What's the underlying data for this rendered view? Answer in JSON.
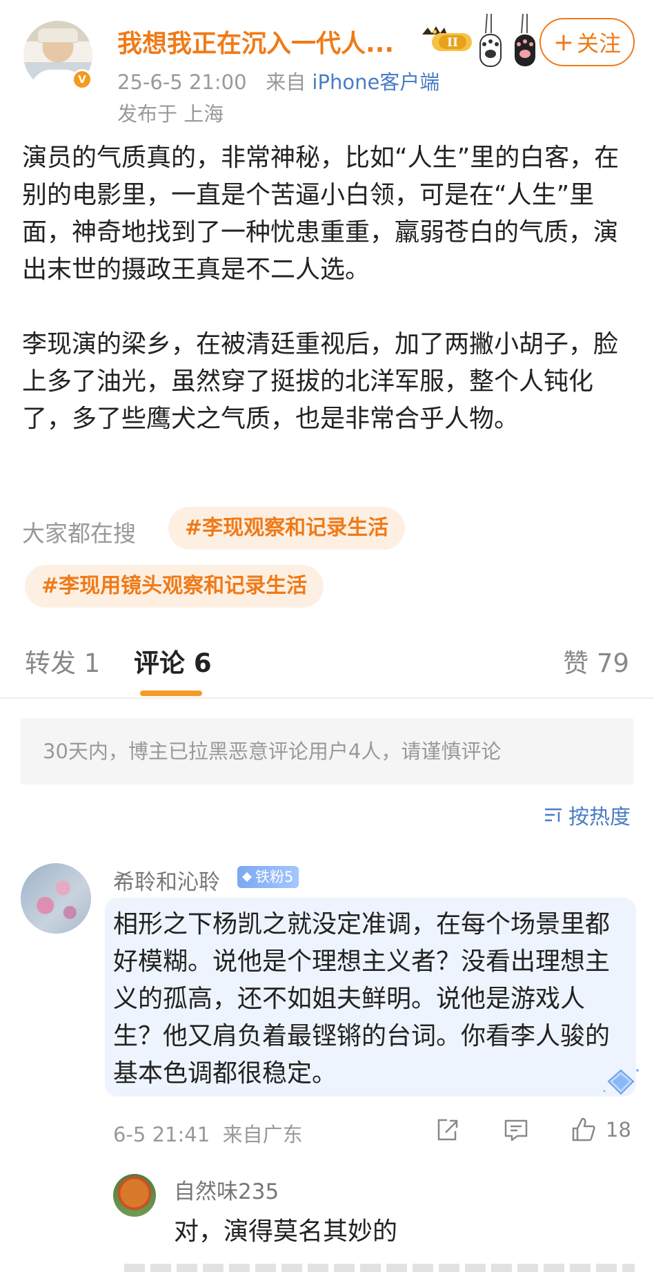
{
  "post": {
    "author": "我想我正在沉入一代人...",
    "verified_mark": "V",
    "level_badge": "II",
    "follow_label": "关注",
    "follow_plus": "+",
    "date": "25-6-5 21:00",
    "source_prefix": "来自",
    "source": "iPhone客户端",
    "location": "发布于 上海",
    "paragraphs": [
      "演员的气质真的，非常神秘，比如“人生”里的白客，在别的电影里，一直是个苦逼小白领，可是在“人生”里面，神奇地找到了一种忧患重重，羸弱苍白的气质，演出末世的摄政王真是不二人选。",
      "李现演的梁乡，在被清廷重视后，加了两撇小胡子，脸上多了油光，虽然穿了挺拔的北洋军服，整个人钝化了，多了些鹰犬之气质，也是非常合乎人物。"
    ],
    "search_label": "大家都在搜",
    "tags": [
      "#李现观察和记录生活",
      "#李现用镜头观察和记录生活"
    ]
  },
  "tabs": {
    "repost": "转发 1",
    "comment": "评论 6",
    "like": "赞 79"
  },
  "notice": "30天内，博主已拉黑恶意评论用户4人，请谨慎评论",
  "sort": "按热度",
  "comments": [
    {
      "user": "希聆和沁聆",
      "badge": "铁粉5",
      "text": "相形之下杨凯之就没定准调，在每个场景里都好模糊。说他是个理想主义者？没看出理想主义的孤高，还不如姐夫鲜明。说他是游戏人生？他又肩负着最铿锵的台词。你看李人骏的基本色调都很稳定。",
      "date": "6-5 21:41",
      "source": "来自广东",
      "likes": "18",
      "reply": {
        "user": "自然味235",
        "text": "对，演得莫名其妙的"
      }
    }
  ],
  "colors": {
    "accent": "#f07a18",
    "link": "#4a7cc4",
    "tab_underline": "#f59a23",
    "bubble": "#eef4fd"
  },
  "icons": [
    "verified-icon",
    "crown-level-icon",
    "paw-icon",
    "sort-icon",
    "share-icon",
    "comment-icon",
    "like-icon",
    "fan-diamond-icon"
  ]
}
